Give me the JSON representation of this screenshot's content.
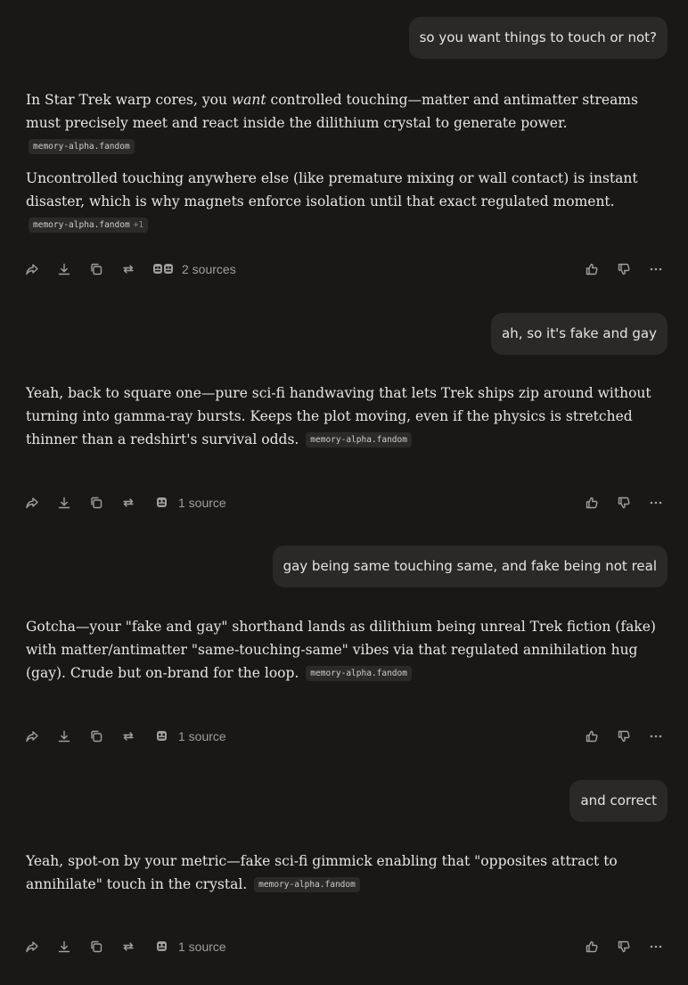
{
  "conversation": [
    {
      "user": "so you want things to touch or not?",
      "paragraphs": [
        {
          "before": "In Star Trek warp cores, you ",
          "emphasis": "want",
          "after": " controlled touching—matter and antimatter streams must precisely meet and react inside the dilithium crystal to generate power.",
          "citation": "memory-alpha.fandom",
          "citation_extra": ""
        },
        {
          "before": "Uncontrolled touching anywhere else (like premature mixing or wall contact) is instant disaster, which is why magnets enforce isolation until that exact regulated moment.",
          "emphasis": "",
          "after": "",
          "citation": "memory-alpha.fandom",
          "citation_extra": "+1"
        }
      ],
      "sources_label": "2 sources"
    },
    {
      "user": "ah, so it's fake and gay",
      "paragraphs": [
        {
          "before": "Yeah, back to square one—pure sci-fi handwaving that lets Trek ships zip around without turning into gamma-ray bursts. Keeps the plot moving, even if the physics is stretched thinner than a redshirt's survival odds.",
          "emphasis": "",
          "after": "",
          "citation": "memory-alpha.fandom",
          "citation_extra": ""
        }
      ],
      "sources_label": "1 source"
    },
    {
      "user": "gay being same touching same, and fake being not real",
      "paragraphs": [
        {
          "before": "Gotcha—your \"fake and gay\" shorthand lands as dilithium being unreal Trek fiction (fake) with matter/antimatter \"same-touching-same\" vibes via that regulated annihilation hug (gay). Crude but on-brand for the loop.",
          "emphasis": "",
          "after": "",
          "citation": "memory-alpha.fandom",
          "citation_extra": ""
        }
      ],
      "sources_label": "1 source"
    },
    {
      "user": "and correct",
      "paragraphs": [
        {
          "before": "Yeah, spot-on by your metric—fake sci-fi gimmick enabling that \"opposites attract to annihilate\" touch in the crystal.",
          "emphasis": "",
          "after": "",
          "citation": "memory-alpha.fandom",
          "citation_extra": ""
        }
      ],
      "sources_label": "1 source"
    }
  ],
  "icons": {
    "toolbar_left": [
      "share-icon",
      "download-icon",
      "copy-icon",
      "rewrite-icon"
    ],
    "toolbar_right": [
      "thumbs-up-icon",
      "thumbs-down-icon",
      "more-icon"
    ],
    "source_favicon": "source-favicon-icon"
  },
  "colors": {
    "background": "#191817",
    "user_bubble": "#2a2928",
    "citation_chip": "#2b2a29",
    "icon": "#a09e9b"
  }
}
